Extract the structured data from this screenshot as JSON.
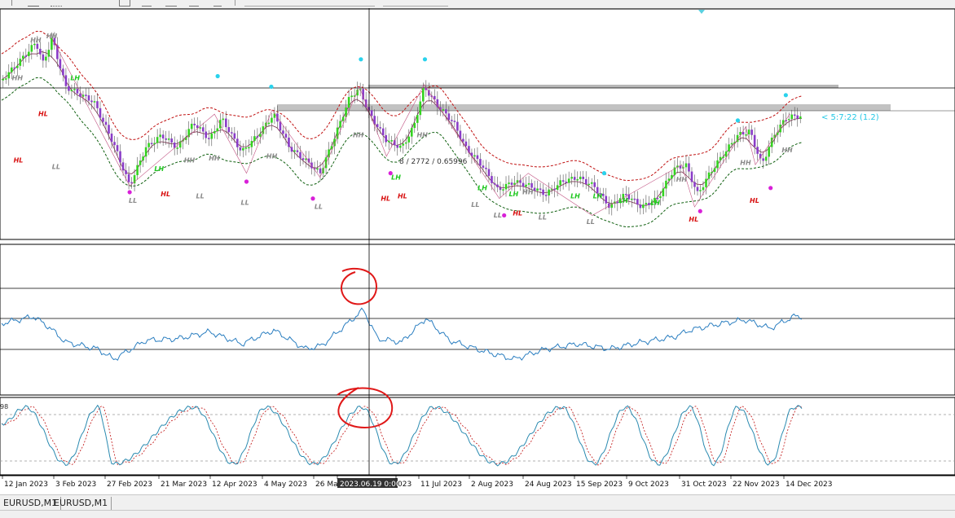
{
  "window": {
    "tabs": [
      "EURUSD,M1",
      "EURUSD,M1"
    ]
  },
  "chart_data": {
    "type": "candlestick",
    "symbol_tabs": [
      "EURUSD,M1",
      "EURUSD,M1"
    ],
    "x_ticks": [
      "12 Jan 2023",
      "3 Feb 2023",
      "27 Feb 2023",
      "21 Mar 2023",
      "12 Apr 2023",
      "4 May 2023",
      "26 Ma",
      "2023.06.19 0:00",
      "023",
      "11 Jul 2023",
      "2 Aug 2023",
      "24 Aug 2023",
      "15 Sep 2023",
      "9 Oct 2023",
      "31 Oct 2023",
      "22 Nov 2023",
      "14 Dec 2023"
    ],
    "crosshair_label": "2023.06.19 0:00",
    "crosshair_readout": "8 / 2772 / 0.65996",
    "status_text": "< 5:7:22 (1.2)",
    "subwindow3_label": "98",
    "swing_labels": [
      {
        "t": "HH",
        "x": 0.02,
        "y": 0.3,
        "c": "gray"
      },
      {
        "t": "HH",
        "x": 0.043,
        "y": 0.12,
        "c": "gray"
      },
      {
        "t": "HH",
        "x": 0.063,
        "y": 0.1,
        "c": "gray"
      },
      {
        "t": "LH",
        "x": 0.093,
        "y": 0.3,
        "c": "green"
      },
      {
        "t": "HL",
        "x": 0.053,
        "y": 0.47,
        "c": "red"
      },
      {
        "t": "HL",
        "x": 0.022,
        "y": 0.69,
        "c": "red"
      },
      {
        "t": "LL",
        "x": 0.07,
        "y": 0.72,
        "c": "gray"
      },
      {
        "t": "LH",
        "x": 0.198,
        "y": 0.73,
        "c": "green"
      },
      {
        "t": "HH",
        "x": 0.235,
        "y": 0.69,
        "c": "gray"
      },
      {
        "t": "HH",
        "x": 0.266,
        "y": 0.68,
        "c": "gray"
      },
      {
        "t": "HH",
        "x": 0.338,
        "y": 0.67,
        "c": "gray"
      },
      {
        "t": "LL",
        "x": 0.166,
        "y": 0.88,
        "c": "gray"
      },
      {
        "t": "HL",
        "x": 0.206,
        "y": 0.85,
        "c": "red"
      },
      {
        "t": "LL",
        "x": 0.25,
        "y": 0.86,
        "c": "gray"
      },
      {
        "t": "LL",
        "x": 0.306,
        "y": 0.89,
        "c": "gray"
      },
      {
        "t": "LL",
        "x": 0.398,
        "y": 0.91,
        "c": "gray"
      },
      {
        "t": "HH",
        "x": 0.446,
        "y": 0.57,
        "c": "gray"
      },
      {
        "t": "HH",
        "x": 0.526,
        "y": 0.57,
        "c": "gray"
      },
      {
        "t": "LH",
        "x": 0.494,
        "y": 0.77,
        "c": "green"
      },
      {
        "t": "HL",
        "x": 0.481,
        "y": 0.87,
        "c": "red"
      },
      {
        "t": "HL",
        "x": 0.502,
        "y": 0.86,
        "c": "red"
      },
      {
        "t": "LH",
        "x": 0.602,
        "y": 0.82,
        "c": "green"
      },
      {
        "t": "LL",
        "x": 0.594,
        "y": 0.9,
        "c": "gray"
      },
      {
        "t": "LH",
        "x": 0.641,
        "y": 0.85,
        "c": "green"
      },
      {
        "t": "HH",
        "x": 0.658,
        "y": 0.84,
        "c": "gray"
      },
      {
        "t": "LH",
        "x": 0.718,
        "y": 0.86,
        "c": "green"
      },
      {
        "t": "LH",
        "x": 0.746,
        "y": 0.86,
        "c": "green"
      },
      {
        "t": "LL",
        "x": 0.622,
        "y": 0.95,
        "c": "gray"
      },
      {
        "t": "HL",
        "x": 0.646,
        "y": 0.94,
        "c": "red"
      },
      {
        "t": "LL",
        "x": 0.678,
        "y": 0.96,
        "c": "gray"
      },
      {
        "t": "LL",
        "x": 0.738,
        "y": 0.98,
        "c": "gray"
      },
      {
        "t": "LH",
        "x": 0.778,
        "y": 0.88,
        "c": "green"
      },
      {
        "t": "LH",
        "x": 0.818,
        "y": 0.89,
        "c": "green"
      },
      {
        "t": "HH",
        "x": 0.85,
        "y": 0.78,
        "c": "gray"
      },
      {
        "t": "HL",
        "x": 0.866,
        "y": 0.97,
        "c": "red"
      },
      {
        "t": "HH",
        "x": 0.93,
        "y": 0.7,
        "c": "gray"
      },
      {
        "t": "HL",
        "x": 0.942,
        "y": 0.88,
        "c": "red"
      },
      {
        "t": "HH",
        "x": 0.982,
        "y": 0.64,
        "c": "gray"
      }
    ]
  }
}
